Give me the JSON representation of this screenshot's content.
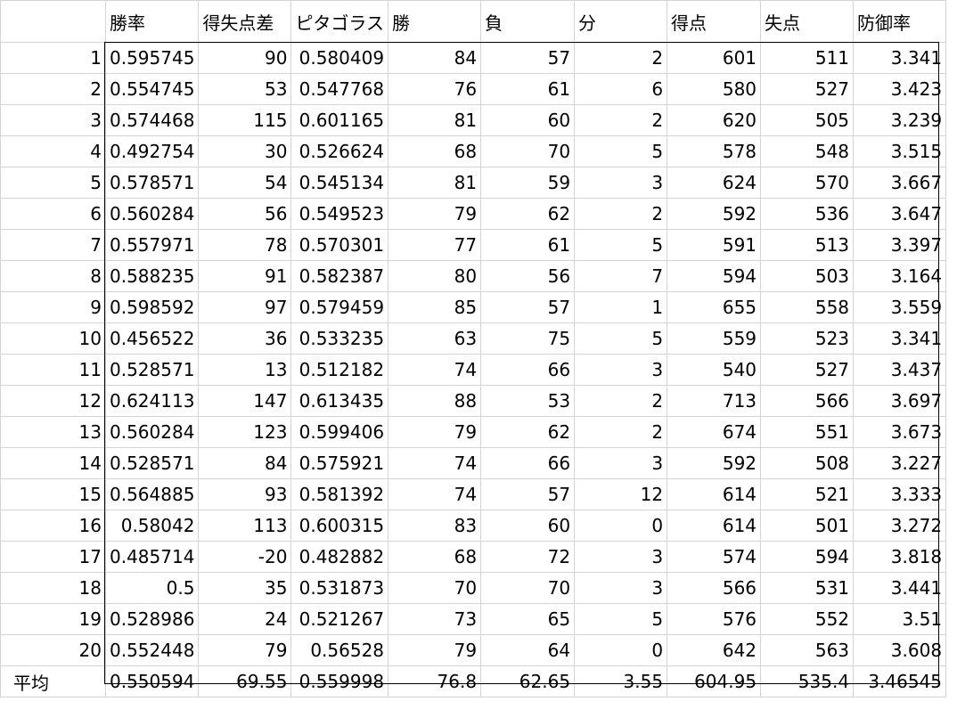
{
  "headers": [
    "",
    "勝率",
    "得失点差",
    "ピタゴラス",
    "勝",
    "負",
    "分",
    "得点",
    "失点",
    "防御率"
  ],
  "rows": [
    [
      "1",
      "0.595745",
      "90",
      "0.580409",
      "84",
      "57",
      "2",
      "601",
      "511",
      "3.341"
    ],
    [
      "2",
      "0.554745",
      "53",
      "0.547768",
      "76",
      "61",
      "6",
      "580",
      "527",
      "3.423"
    ],
    [
      "3",
      "0.574468",
      "115",
      "0.601165",
      "81",
      "60",
      "2",
      "620",
      "505",
      "3.239"
    ],
    [
      "4",
      "0.492754",
      "30",
      "0.526624",
      "68",
      "70",
      "5",
      "578",
      "548",
      "3.515"
    ],
    [
      "5",
      "0.578571",
      "54",
      "0.545134",
      "81",
      "59",
      "3",
      "624",
      "570",
      "3.667"
    ],
    [
      "6",
      "0.560284",
      "56",
      "0.549523",
      "79",
      "62",
      "2",
      "592",
      "536",
      "3.647"
    ],
    [
      "7",
      "0.557971",
      "78",
      "0.570301",
      "77",
      "61",
      "5",
      "591",
      "513",
      "3.397"
    ],
    [
      "8",
      "0.588235",
      "91",
      "0.582387",
      "80",
      "56",
      "7",
      "594",
      "503",
      "3.164"
    ],
    [
      "9",
      "0.598592",
      "97",
      "0.579459",
      "85",
      "57",
      "1",
      "655",
      "558",
      "3.559"
    ],
    [
      "10",
      "0.456522",
      "36",
      "0.533235",
      "63",
      "75",
      "5",
      "559",
      "523",
      "3.341"
    ],
    [
      "11",
      "0.528571",
      "13",
      "0.512182",
      "74",
      "66",
      "3",
      "540",
      "527",
      "3.437"
    ],
    [
      "12",
      "0.624113",
      "147",
      "0.613435",
      "88",
      "53",
      "2",
      "713",
      "566",
      "3.697"
    ],
    [
      "13",
      "0.560284",
      "123",
      "0.599406",
      "79",
      "62",
      "2",
      "674",
      "551",
      "3.673"
    ],
    [
      "14",
      "0.528571",
      "84",
      "0.575921",
      "74",
      "66",
      "3",
      "592",
      "508",
      "3.227"
    ],
    [
      "15",
      "0.564885",
      "93",
      "0.581392",
      "74",
      "57",
      "12",
      "614",
      "521",
      "3.333"
    ],
    [
      "16",
      "0.58042",
      "113",
      "0.600315",
      "83",
      "60",
      "0",
      "614",
      "501",
      "3.272"
    ],
    [
      "17",
      "0.485714",
      "-20",
      "0.482882",
      "68",
      "72",
      "3",
      "574",
      "594",
      "3.818"
    ],
    [
      "18",
      "0.5",
      "35",
      "0.531873",
      "70",
      "70",
      "3",
      "566",
      "531",
      "3.441"
    ],
    [
      "19",
      "0.528986",
      "24",
      "0.521267",
      "73",
      "65",
      "5",
      "576",
      "552",
      "3.51"
    ],
    [
      "20",
      "0.552448",
      "79",
      "0.56528",
      "79",
      "64",
      "0",
      "642",
      "563",
      "3.608"
    ]
  ],
  "average": [
    "平均",
    "0.550594",
    "69.55",
    "0.559998",
    "76.8",
    "62.65",
    "3.55",
    "604.95",
    "535.4",
    "3.46545"
  ]
}
